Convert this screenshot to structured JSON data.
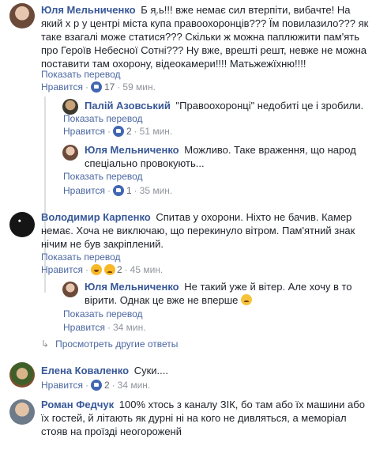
{
  "comments": [
    {
      "author": "Юля Мельниченко",
      "text": "Б  я̦.ь!!! вже немає сил втерпіти, вибачте! На який х  р у центрі міста купа правоохоронців??? Їм повилазило??? як таке взагалі може статися??? Скільки ж можна паплюжити пам'ять про Героїв Небесної Сотні??? Ну вже, врешті решт, невже не можна поставити там охорону, відеокамери!!!! Матьжежїхню!!!!",
      "translate": "Показать перевод",
      "like": "Нравится",
      "reply": "Ответить",
      "count": "17",
      "time": "59 мин."
    },
    {
      "author": "Палій Азовський",
      "text": "\"Правоохоронці\" недобиті це і зробили.",
      "translate": "Показать перевод",
      "like": "Нравится",
      "count": "2",
      "time": "51 мин."
    },
    {
      "author": "Юля Мельниченко",
      "text": "Можливо. Таке враження, що народ спеціально провокують...",
      "translate": "Показать перевод",
      "like": "Нравится",
      "count": "1",
      "time": "35 мин."
    },
    {
      "author": "Володимир Карпенко",
      "text": "Спитав у охорони. Ніхто не бачив. Камер немає. Хоча не виключаю, що перекинуло вітром. Пам'ятний знак нічим не був закріплений.",
      "translate": "Показать перевод",
      "like": "Нравится",
      "count": "2",
      "time": "45 мин."
    },
    {
      "author": "Юля Мельниченко",
      "text": "Не такий уже й вітер. Але хочу в то вірити. Однак це вже не вперше",
      "translate": "Показать перевод",
      "like": "Нравится",
      "time": "34 мин."
    },
    {
      "author": "Елена Коваленко",
      "text": "Суки....",
      "like": "Нравится",
      "count": "2",
      "time": "34 мин."
    },
    {
      "author": "Роман Федчук",
      "text": "100% хтось з каналу ЗІК, бо там або їх машини або їх гостей, й літають як дурні ні на кого не дивляться, а меморіал стояв на проїзді неогороженй"
    }
  ],
  "more_replies": "Просмотреть другие ответы",
  "colors": {
    "link": "#385898",
    "like_blue": "#4267b2",
    "secondary": "#90949c"
  }
}
